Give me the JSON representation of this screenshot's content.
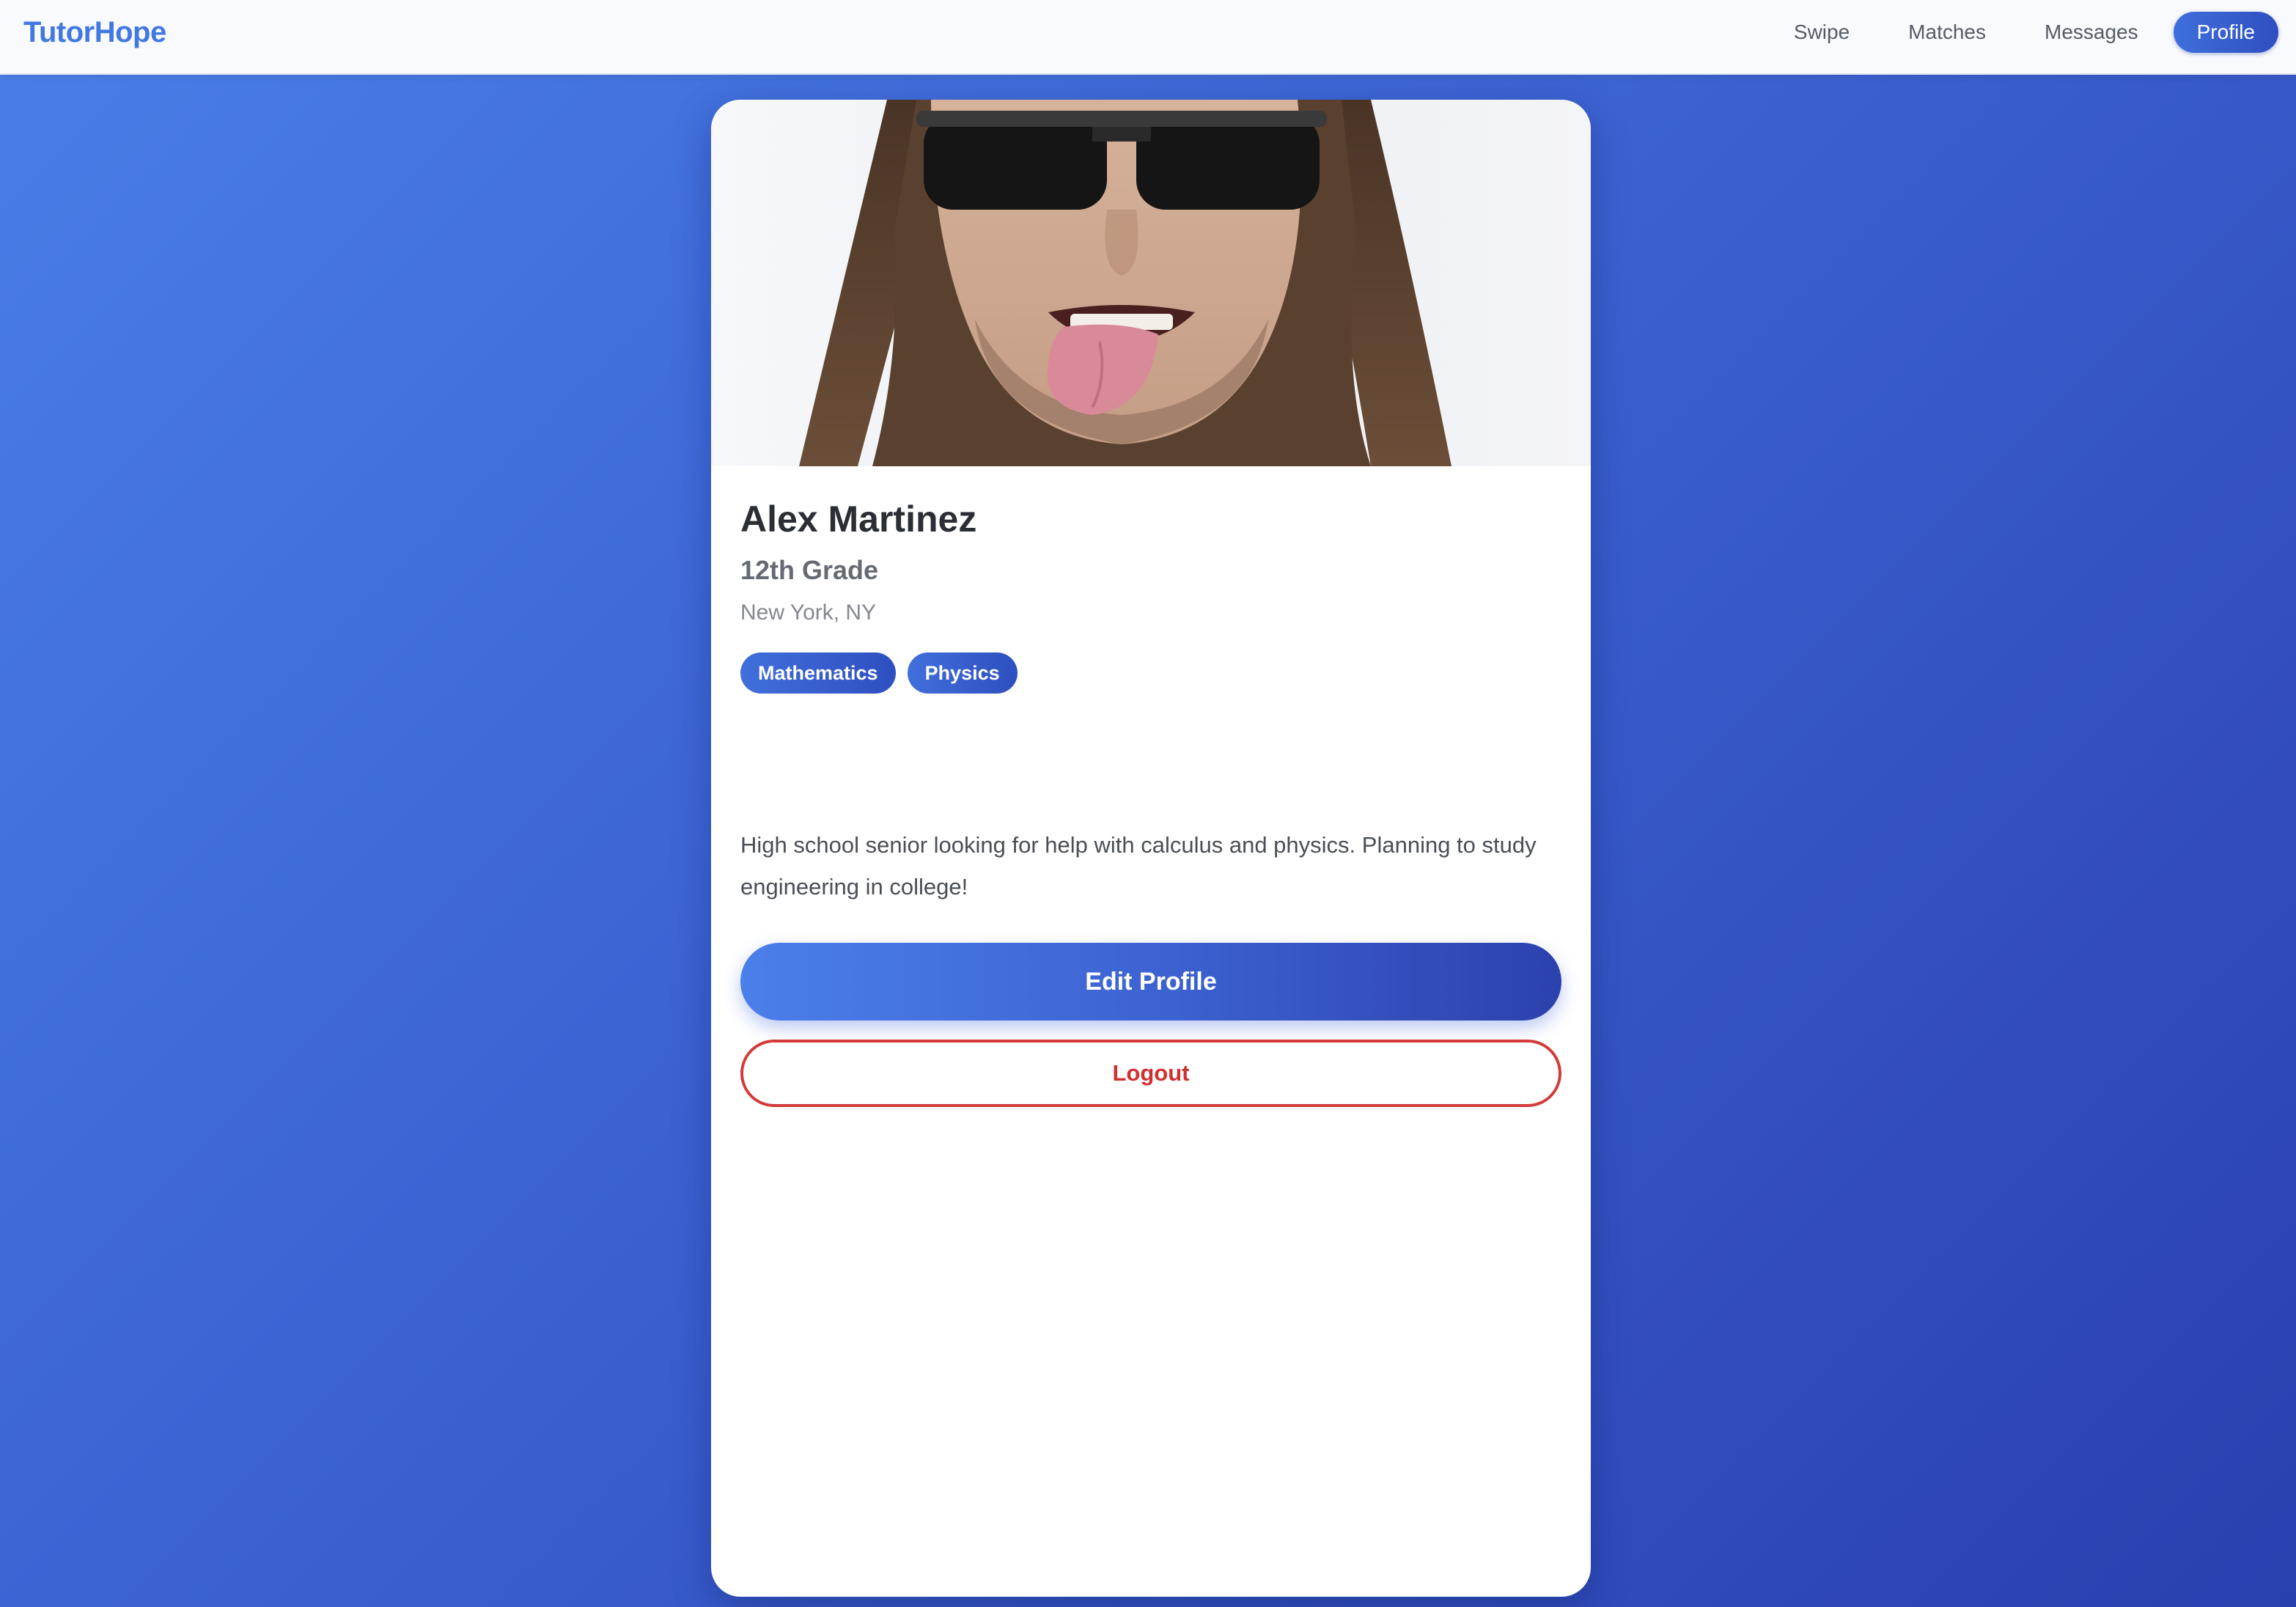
{
  "app": {
    "logo": "TutorHope",
    "accent_color": "#4178e2"
  },
  "nav": {
    "items": [
      {
        "label": "Swipe"
      },
      {
        "label": "Matches"
      },
      {
        "label": "Messages"
      },
      {
        "label": "Profile",
        "active": true
      }
    ]
  },
  "profile": {
    "photo_icon": "profile-photo",
    "name": "Alex Martinez",
    "grade": "12th Grade",
    "location": "New York, NY",
    "subjects": [
      "Mathematics",
      "Physics"
    ],
    "bio": "High school senior looking for help with calculus and physics. Planning to study engineering in college!"
  },
  "actions": {
    "edit_label": "Edit Profile",
    "logout_label": "Logout",
    "logout_color": "#d0302e"
  }
}
